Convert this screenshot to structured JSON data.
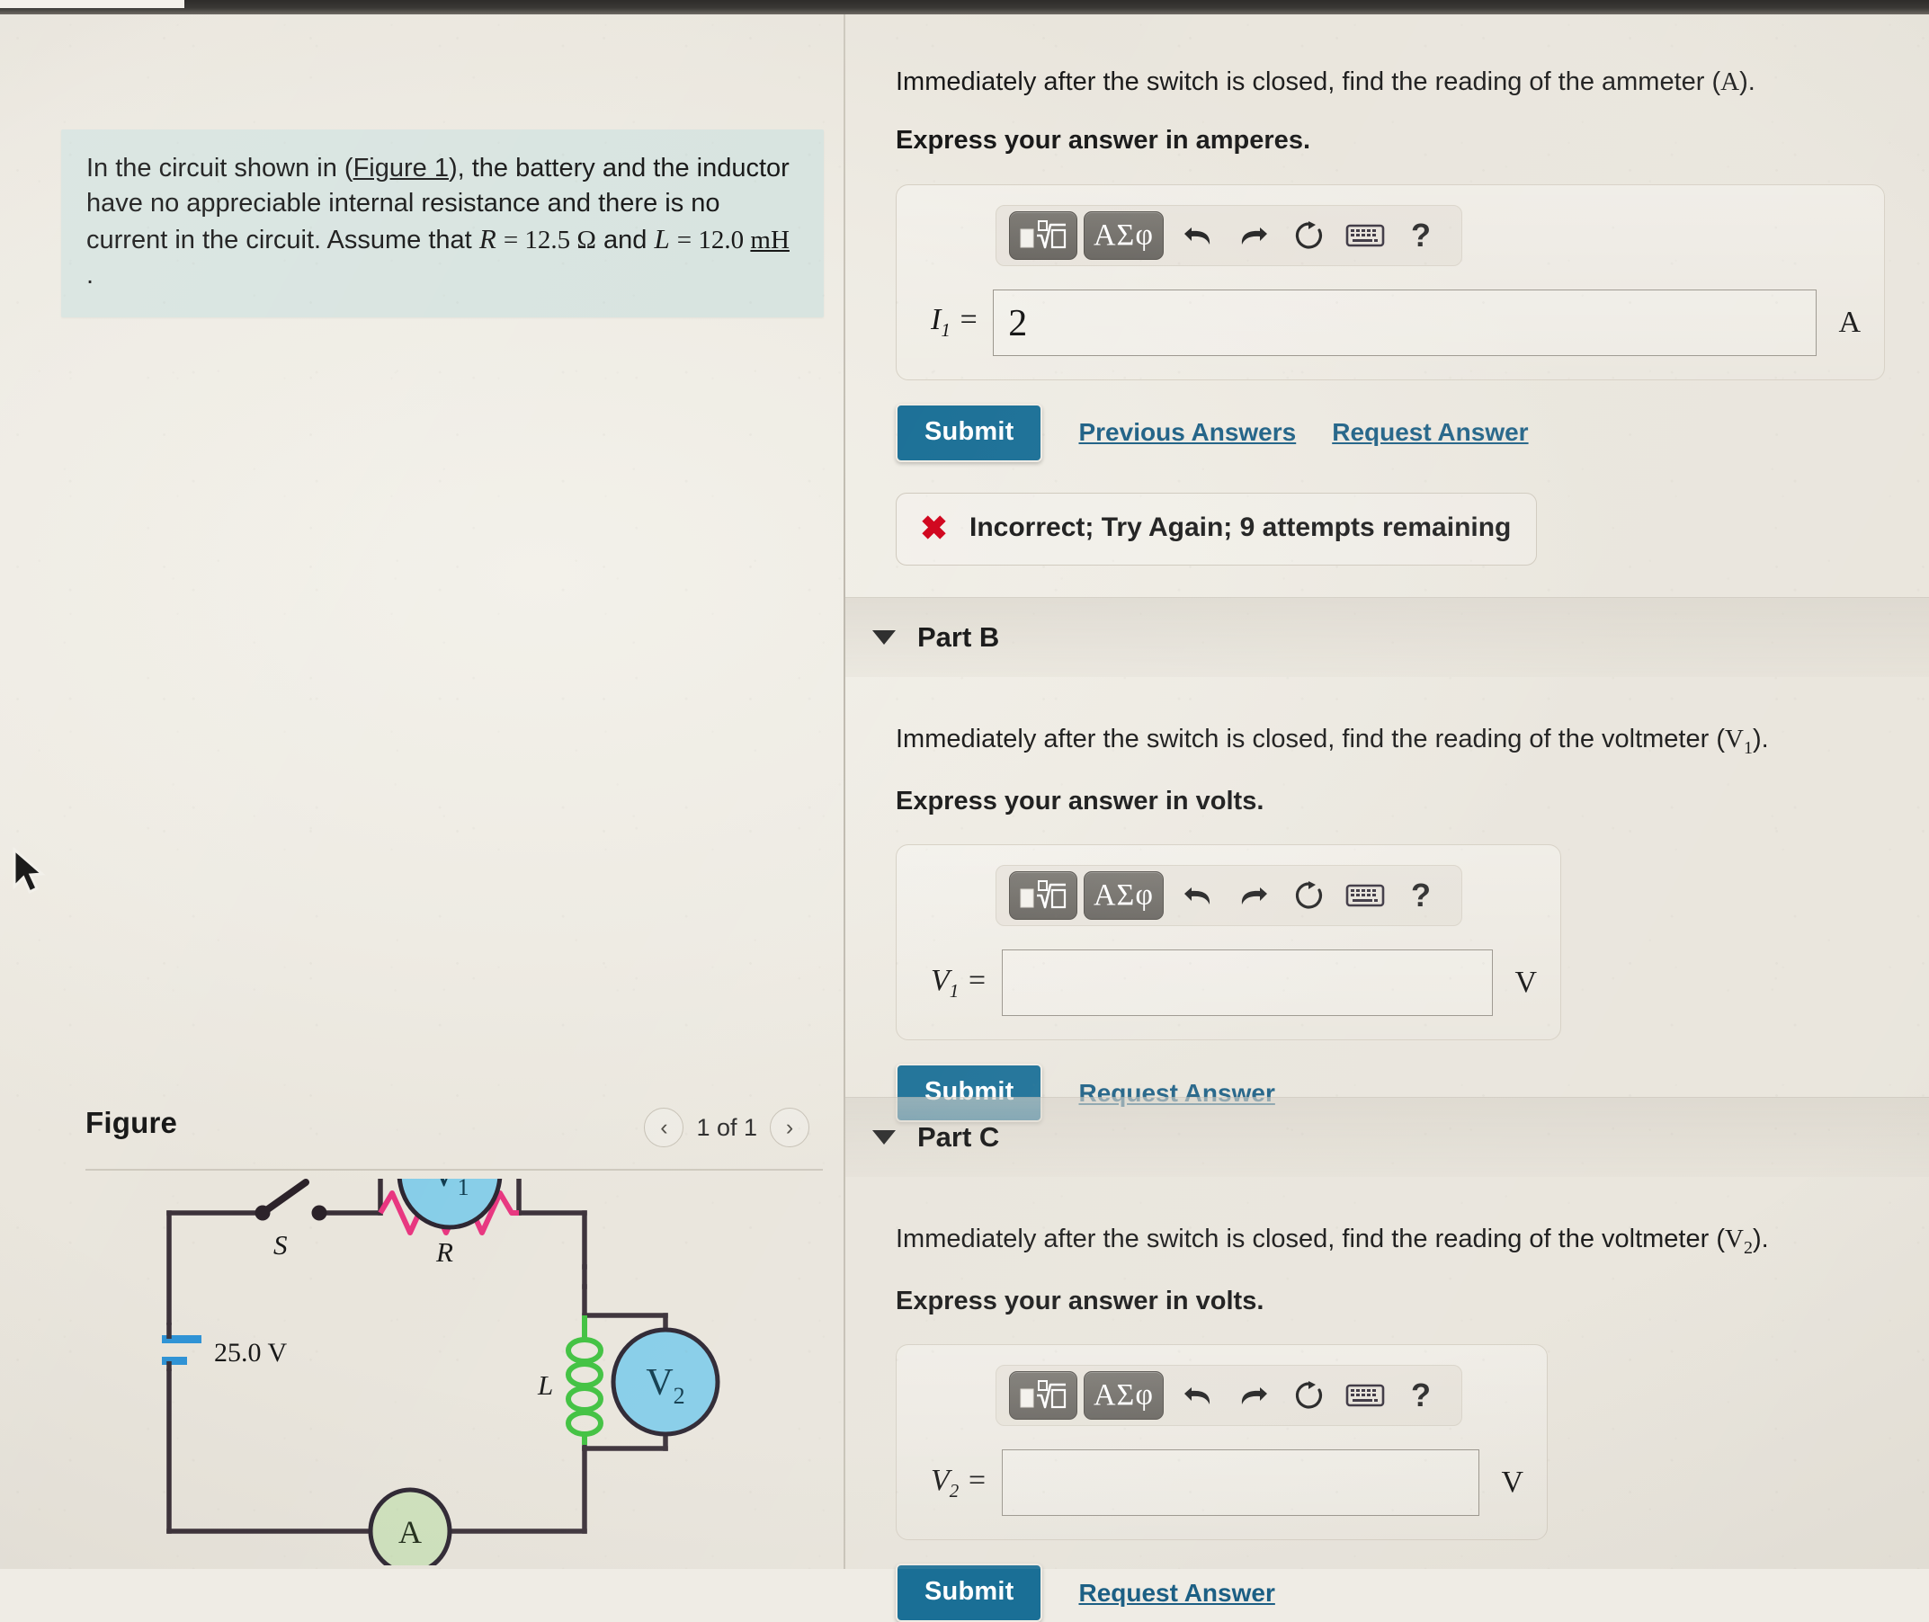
{
  "problem": {
    "text_before_link": "In the circuit shown in (",
    "figure_link": "Figure 1",
    "text_after_link": "), the battery and the inductor have no appreciable internal resistance and there is no current in the circuit. Assume that ",
    "R_symbol": "R",
    "R_value": "= 12.5 Ω",
    "and_text": " and ",
    "L_symbol": "L",
    "L_value": "= 12.0 ",
    "L_unit": "mH",
    "period": "."
  },
  "figure": {
    "title": "Figure",
    "pager_label": "1 of 1",
    "prev_icon": "‹",
    "next_icon": "›",
    "circuit": {
      "battery_label": "25.0 V",
      "battery_plus": "+",
      "switch_label": "S",
      "resistor_label": "R",
      "inductor_label": "L",
      "voltmeter1_label": "V",
      "voltmeter1_sub": "1",
      "voltmeter2_label": "V",
      "voltmeter2_sub": "2",
      "ammeter_label": "A",
      "wire_color": "#3a3038",
      "resistor_color": "#e8357f",
      "inductor_color": "#3fc13f",
      "meter_blue": "#86cde8",
      "meter_green": "#cfe2bd",
      "battery_plate_color": "#2e93d6"
    }
  },
  "toolbar": {
    "template_icon": "template-icon",
    "greek_label": "ΑΣφ",
    "undo_icon": "undo-icon",
    "redo_icon": "redo-icon",
    "reset_icon": "reset-icon",
    "keyboard_icon": "keyboard-icon",
    "help_label": "?"
  },
  "parts": [
    {
      "id": "A",
      "show_header": false,
      "header_title": "",
      "question": "Immediately after the switch is closed, find the reading of the ammeter (",
      "question_symbol": "A",
      "question_tail": ").",
      "instruction": "Express your answer in amperes.",
      "field_symbol": "I",
      "field_sub": "1",
      "field_eq": "=",
      "field_value": "2",
      "field_unit": "A",
      "submit_label": "Submit",
      "previous_label": "Previous Answers",
      "request_label": "Request Answer",
      "has_previous": true,
      "feedback": {
        "icon": "✖",
        "text": "Incorrect; Try Again; 9 attempts remaining"
      }
    },
    {
      "id": "B",
      "show_header": true,
      "header_title": "Part B",
      "question": "Immediately after the switch is closed, find the reading of the voltmeter (",
      "question_symbol": "V",
      "question_sub": "1",
      "question_tail": ").",
      "instruction": "Express your answer in volts.",
      "field_symbol": "V",
      "field_sub": "1",
      "field_eq": "=",
      "field_value": "",
      "field_unit": "V",
      "submit_label": "Submit",
      "request_label": "Request Answer",
      "has_previous": false
    },
    {
      "id": "C",
      "show_header": true,
      "header_title": "Part C",
      "question": "Immediately after the switch is closed, find the reading of the voltmeter (",
      "question_symbol": "V",
      "question_sub": "2",
      "question_tail": ").",
      "instruction": "Express your answer in volts.",
      "field_symbol": "V",
      "field_sub": "2",
      "field_eq": "=",
      "field_value": "",
      "field_unit": "V",
      "submit_label": "Submit",
      "request_label": "Request Answer",
      "has_previous": false
    }
  ],
  "colors": {
    "accent_blue": "#1a6f96",
    "link_blue": "#1c5f84",
    "error_red": "#d0021b",
    "statement_bg": "#d8e4e0"
  }
}
